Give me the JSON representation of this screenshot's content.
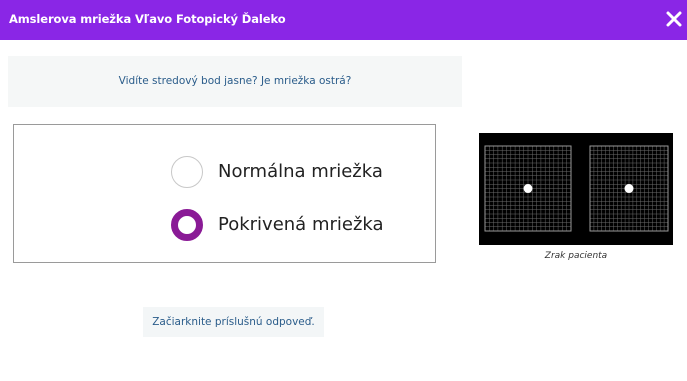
{
  "dialog": {
    "title": "Amslerova mriežka Vľavo Fotopický Ďaleko",
    "close_icon": "close-icon",
    "accent_color": "#8a26e6"
  },
  "question": {
    "text": "Vidíte stredový bod jasne? Je mriežka ostrá?"
  },
  "options": [
    {
      "label": "Normálna mriežka",
      "selected": false
    },
    {
      "label": "Pokrivená mriežka",
      "selected": true
    }
  ],
  "patient_view": {
    "caption": "Zrak pacienta",
    "grids": [
      "left",
      "right"
    ]
  },
  "instruction": {
    "text": "Začiarknite príslušnú odpoveď."
  },
  "colors": {
    "selected_radio": "#8a1a96",
    "link_text": "#2a5c8a"
  }
}
